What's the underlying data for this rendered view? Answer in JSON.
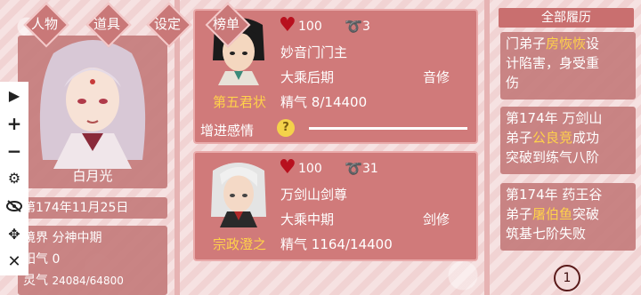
{
  "menu": {
    "items": [
      {
        "label": "人物"
      },
      {
        "label": "道具"
      },
      {
        "label": "设定"
      },
      {
        "label": "榜单"
      }
    ]
  },
  "player": {
    "name": "白月光",
    "date": "第174年11月25日",
    "realm_label": "境界",
    "realm": "分神中期",
    "yang_label": "阳气",
    "yang": "0",
    "qi_label": "灵气",
    "qi": "24084/64800"
  },
  "toolbar": {
    "icons": [
      "play-icon",
      "plus-icon",
      "minus-icon",
      "gear-icon",
      "hide-eye-icon",
      "move-icon",
      "close-icon"
    ]
  },
  "cards": [
    {
      "rank_title": "第五君状",
      "hearts": "100",
      "rings": "3",
      "sect": "妙音门门主",
      "realm": "大乘后期",
      "role": "音修",
      "energy_label": "精气",
      "energy": "8/14400",
      "affection_label": "增进感情",
      "help_icon": "?"
    },
    {
      "rank_title": "宗政澄之",
      "hearts": "100",
      "rings": "31",
      "sect": "万剑山剑尊",
      "realm": "大乘中期",
      "role": "剑修",
      "energy_label": "精气",
      "energy": "1164/14400"
    }
  ],
  "history": {
    "title": "全部履历",
    "entries": [
      {
        "lines": [
          "门弟子房恢恢设",
          "计陷害，身受重",
          "伤"
        ],
        "highlight": "房恢恢"
      },
      {
        "lines": [
          "第174年 万剑山",
          "弟子公良竞成功",
          "突破到练气八阶"
        ],
        "highlight": "公良竞"
      },
      {
        "lines": [
          "第174年 药王谷",
          "弟子屠伯鱼突破",
          "筑基七阶失败"
        ],
        "highlight": "屠伯鱼"
      }
    ],
    "page_number": "1"
  },
  "colors": {
    "panel": "#c47c7c",
    "card": "#d07a7a",
    "highlight": "#ffd24a",
    "heart": "#b8101e"
  }
}
